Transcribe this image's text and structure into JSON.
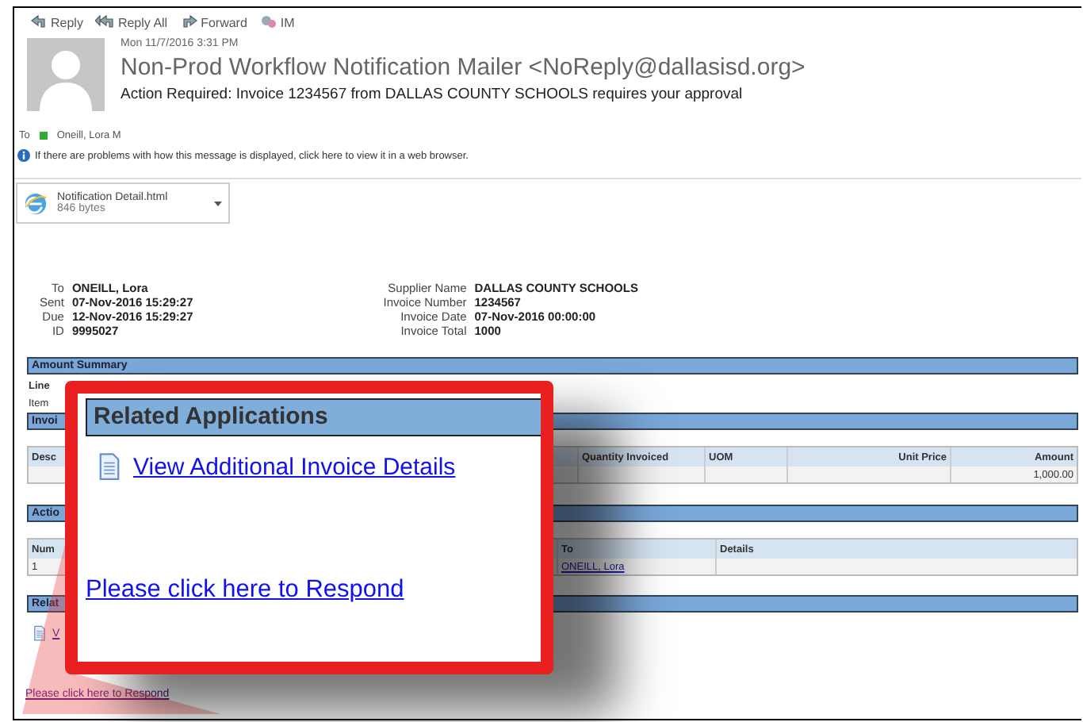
{
  "toolbar": [
    {
      "kind": "reply",
      "label": "Reply"
    },
    {
      "kind": "reply_all",
      "label": "Reply All"
    },
    {
      "kind": "forward",
      "label": "Forward"
    },
    {
      "kind": "im",
      "label": "IM"
    }
  ],
  "message": {
    "date": "Mon 11/7/2016 3:31 PM",
    "sender": "Non-Prod Workflow Notification Mailer <NoReply@dallasisd.org>",
    "subject": "Action Required: Invoice 1234567 from DALLAS COUNTY SCHOOLS requires your approval",
    "to_label": "To",
    "recipient": "Oneill, Lora M",
    "info": "If there are problems with how this message is displayed, click here to view it in a web browser."
  },
  "attachment": {
    "name": "Notification Detail.html",
    "size": "846 bytes"
  },
  "header_fields": {
    "left": [
      {
        "label": "To",
        "value": "ONEILL, Lora"
      },
      {
        "label": "Sent",
        "value": "07-Nov-2016 15:29:27"
      },
      {
        "label": "Due",
        "value": "12-Nov-2016 15:29:27"
      },
      {
        "label": "ID",
        "value": "9995027"
      }
    ],
    "right": [
      {
        "label": "Supplier Name",
        "value": "DALLAS COUNTY SCHOOLS"
      },
      {
        "label": "Invoice Number",
        "value": "1234567"
      },
      {
        "label": "Invoice Date",
        "value": "07-Nov-2016 00:00:00"
      },
      {
        "label": "Invoice Total",
        "value": "1000"
      }
    ]
  },
  "amount_summary": {
    "title": "Amount Summary",
    "line_label": "Line",
    "item_label": "Item"
  },
  "invoice_lines": {
    "title": "Invoi",
    "columns": [
      "Desc",
      "Quantity Invoiced",
      "UOM",
      "Unit Price",
      "Amount"
    ],
    "amount": "1,000.00"
  },
  "actions": {
    "title": "Actio",
    "columns": [
      "Num",
      "To",
      "Details"
    ],
    "num": "1",
    "to": "ONEILL, Lora"
  },
  "related": {
    "title": "Relat",
    "link": "V"
  },
  "respond_link": "Please click here to Respond",
  "callout": {
    "title": "Related Applications",
    "link": "View Additional Invoice Details",
    "respond_link": "Please click here to Respond"
  }
}
